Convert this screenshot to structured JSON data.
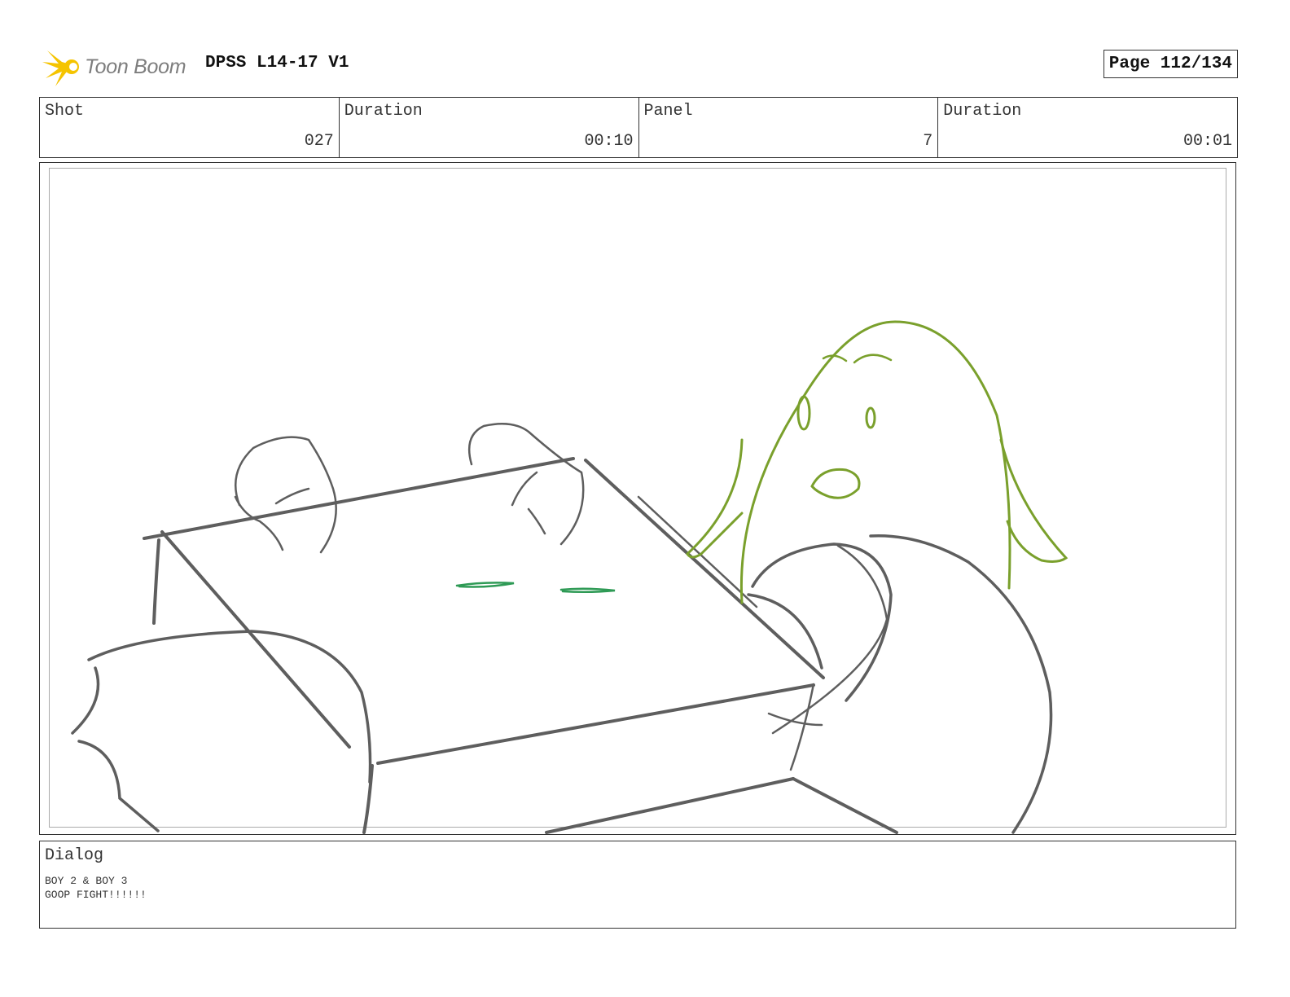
{
  "header": {
    "logo_text": "Toon Boom",
    "project_title": "DPSS L14-17 V1",
    "page": "Page 112/134"
  },
  "info": [
    {
      "label": "Shot",
      "value": "027"
    },
    {
      "label": "Duration",
      "value": "00:10"
    },
    {
      "label": "Panel",
      "value": "7"
    },
    {
      "label": "Duration",
      "value": "00:01"
    }
  ],
  "dialog": {
    "label": "Dialog",
    "lines": [
      "BOY 2 & BOY 3",
      "GOOP FIGHT!!!!!!"
    ]
  },
  "colors": {
    "sketch_gray": "#5e5e5e",
    "character_green": "#7aa02c",
    "goop_green": "#2e9a55",
    "logo_yellow": "#f5c400"
  }
}
